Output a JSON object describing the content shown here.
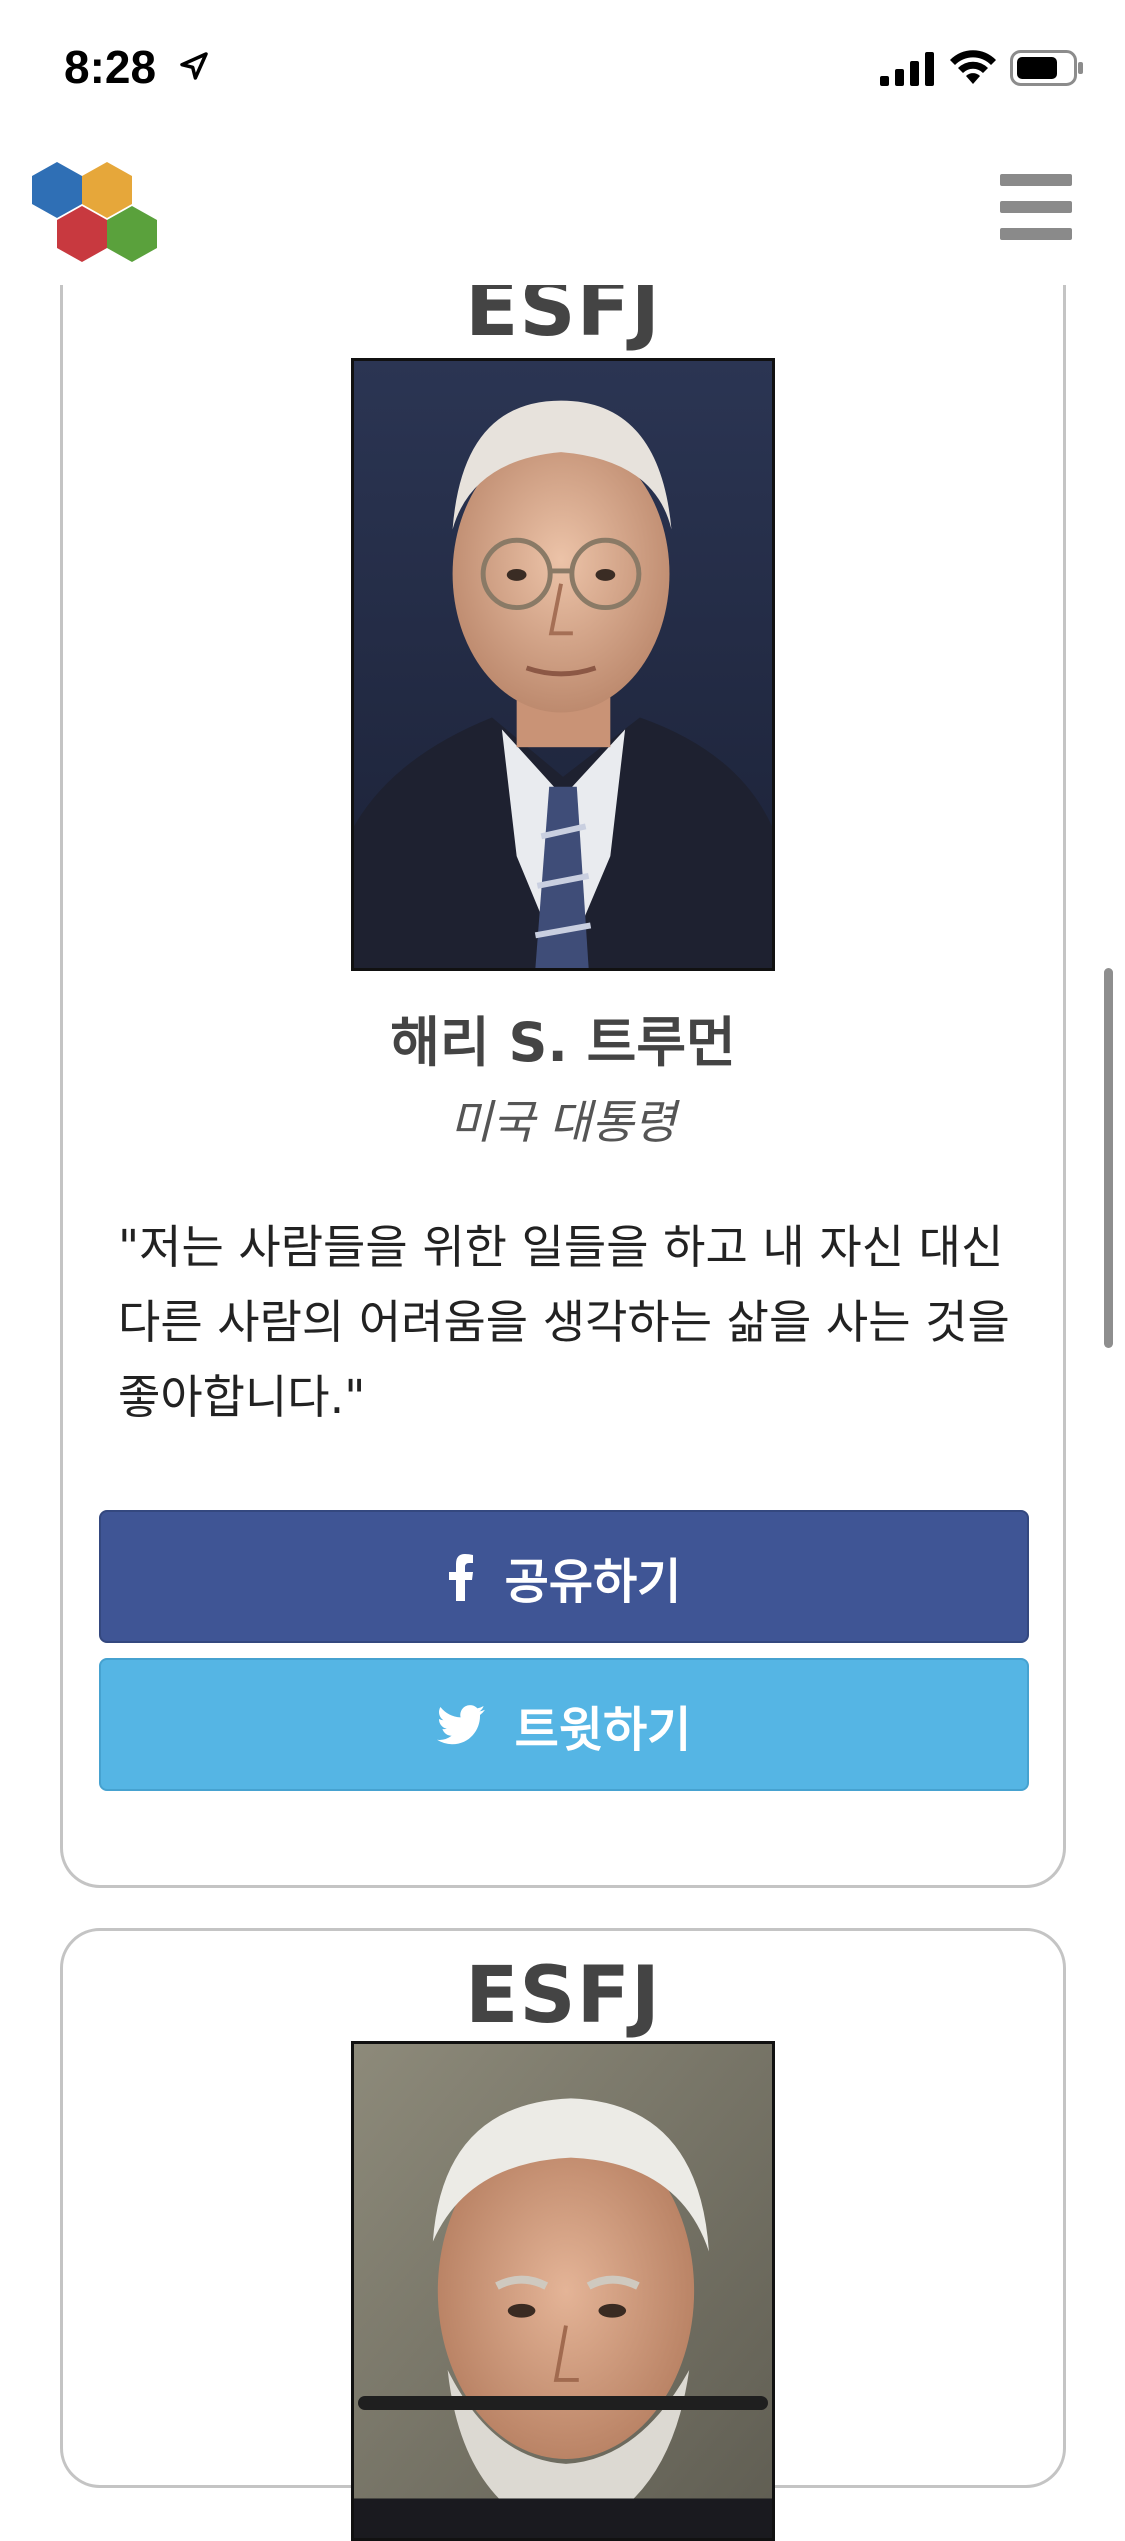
{
  "status_bar": {
    "time": "8:28",
    "icons": [
      "location-arrow-icon",
      "cellular-signal-icon",
      "wifi-icon",
      "battery-icon"
    ]
  },
  "navbar": {
    "logo": "hexagon-logo",
    "menu_icon": "hamburger-menu-icon",
    "logo_colors": [
      "#2f6fb5",
      "#e6a73a",
      "#c8393f",
      "#5aa13c"
    ]
  },
  "cards": [
    {
      "type": "ESFJ",
      "name": "해리 S. 트루먼",
      "title": "미국 대통령",
      "quote": "\"저는 사람들을 위한 일들을 하고 내 자신 대신 다른 사람의 어려움을 생각하는 삶을 사는 것을 좋아합니다.\"",
      "facebook_label": "공유하기",
      "twitter_label": "트윗하기"
    },
    {
      "type": "ESFJ"
    }
  ],
  "colors": {
    "facebook": "#3f5595",
    "twitter": "#55b5e4",
    "card_border": "#c4c4c4"
  }
}
